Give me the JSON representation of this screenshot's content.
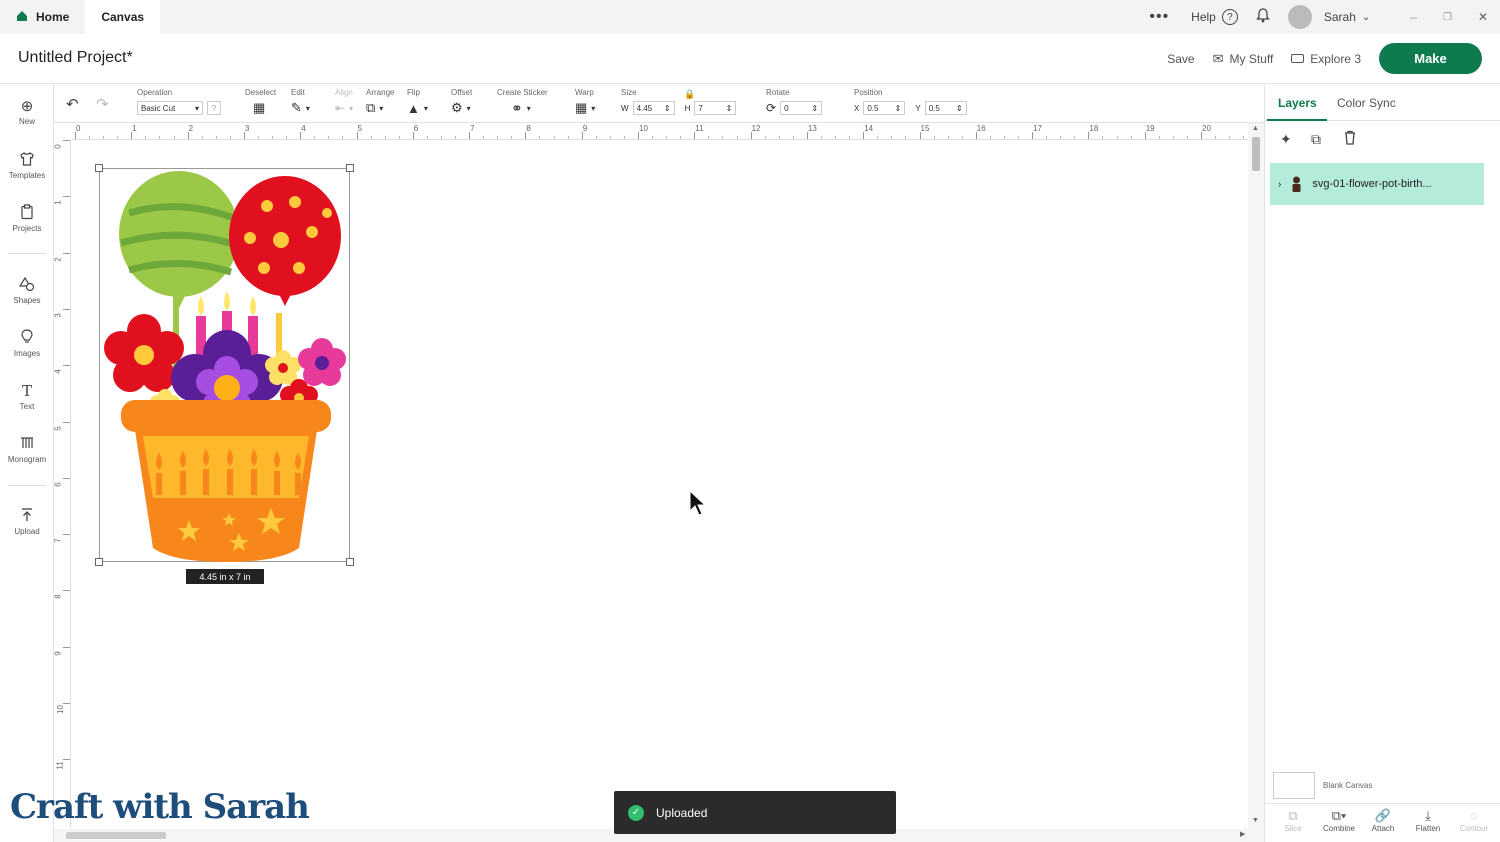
{
  "topbar": {
    "tabs": [
      {
        "label": "Home"
      },
      {
        "label": "Canvas"
      }
    ],
    "help_label": "Help",
    "user_name": "Sarah"
  },
  "header": {
    "project_title": "Untitled Project*",
    "save_label": "Save",
    "mystuff_label": "My Stuff",
    "machine_label": "Explore 3",
    "make_label": "Make"
  },
  "toolbar": {
    "operation_label": "Operation",
    "operation_value": "Basic Cut",
    "deselect_label": "Deselect",
    "edit_label": "Edit",
    "align_label": "Align",
    "arrange_label": "Arrange",
    "flip_label": "Flip",
    "offset_label": "Offset",
    "sticker_label": "Create Sticker",
    "warp_label": "Warp",
    "size_label": "Size",
    "size_w_label": "W",
    "size_w": "4.45",
    "size_h_label": "H",
    "size_h": "7",
    "rotate_label": "Rotate",
    "rotate_value": "0",
    "position_label": "Position",
    "pos_x_label": "X",
    "pos_x": "0.5",
    "pos_y_label": "Y",
    "pos_y": "0.5"
  },
  "sidebar": {
    "items": [
      {
        "label": "New",
        "icon": "plus-circle-icon"
      },
      {
        "label": "Templates",
        "icon": "shirt-icon"
      },
      {
        "label": "Projects",
        "icon": "clipboard-icon"
      },
      {
        "label": "Shapes",
        "icon": "shapes-icon"
      },
      {
        "label": "Images",
        "icon": "bulb-icon"
      },
      {
        "label": "Text",
        "icon": "text-icon"
      },
      {
        "label": "Monogram",
        "icon": "monogram-icon"
      },
      {
        "label": "Upload",
        "icon": "upload-icon"
      }
    ]
  },
  "ruler": {
    "h_ticks": [
      "0",
      "1",
      "2",
      "3",
      "4",
      "5",
      "6",
      "7",
      "8",
      "9",
      "10",
      "11",
      "12",
      "13",
      "14",
      "15",
      "16",
      "17",
      "18",
      "19",
      "20"
    ],
    "v_ticks": [
      "0",
      "1",
      "2",
      "3",
      "4",
      "5",
      "6",
      "7",
      "8",
      "9",
      "10",
      "11"
    ]
  },
  "canvas": {
    "size_badge": "4.45  in x 7  in"
  },
  "right_panel": {
    "tabs": [
      {
        "label": "Layers"
      },
      {
        "label": "Color Sync"
      }
    ],
    "layer_name": "svg-01-flower-pot-birth...",
    "blank_canvas_label": "Blank Canvas",
    "bottom_actions": [
      {
        "label": "Slice",
        "icon": "slice-icon",
        "enabled": false
      },
      {
        "label": "Combine",
        "icon": "combine-icon",
        "enabled": true
      },
      {
        "label": "Attach",
        "icon": "attach-icon",
        "enabled": true
      },
      {
        "label": "Flatten",
        "icon": "flatten-icon",
        "enabled": true
      },
      {
        "label": "Contour",
        "icon": "contour-icon",
        "enabled": false
      }
    ]
  },
  "toast": {
    "message": "Uploaded"
  },
  "watermark": "Craft with Sarah",
  "colors": {
    "accent": "#0f7a4d",
    "layer_highlight": "#b5ebdb"
  }
}
